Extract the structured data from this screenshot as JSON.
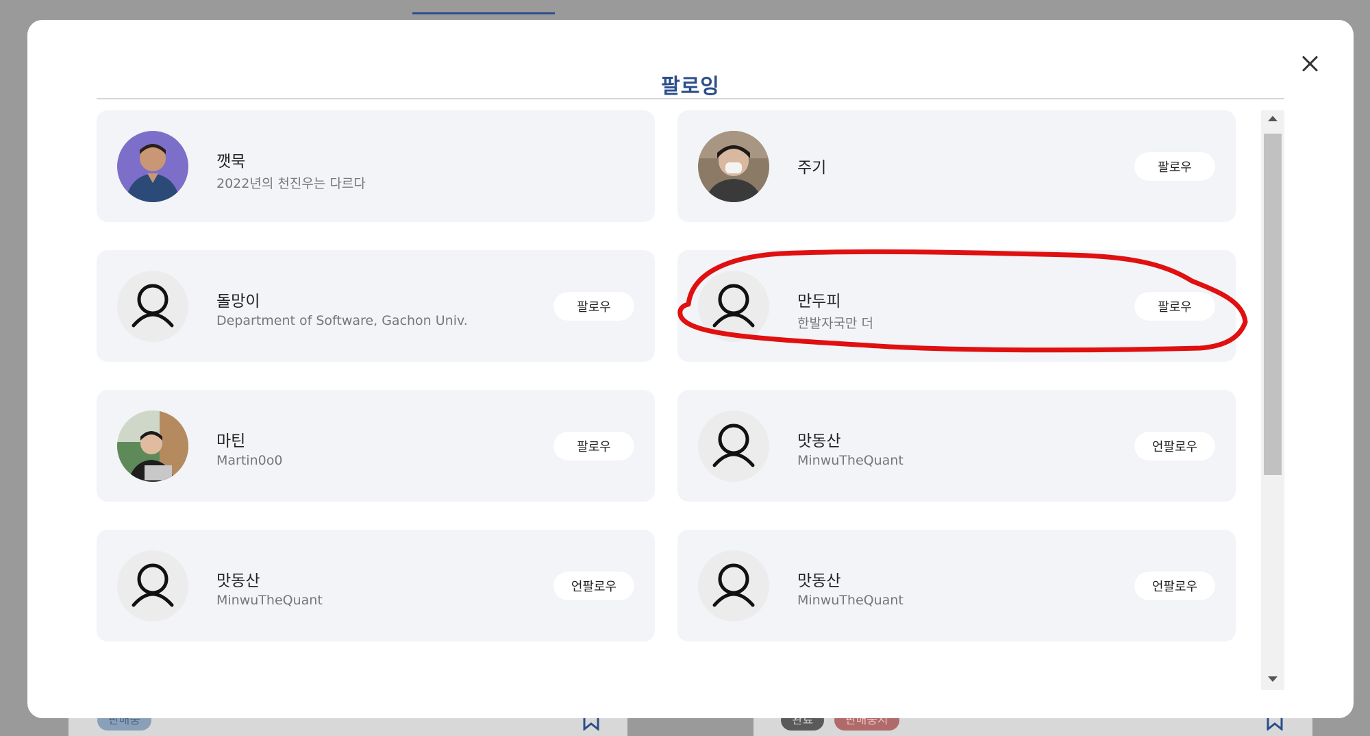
{
  "modal": {
    "title": "팔로잉",
    "close_icon": "close-icon"
  },
  "users": [
    {
      "name": "깻묵",
      "bio": "2022년의 천진우는 다르다",
      "button": "",
      "avatar": "photo"
    },
    {
      "name": "주기",
      "bio": "",
      "button": "팔로우",
      "avatar": "photo"
    },
    {
      "name": "돌망이",
      "bio": "Department of Software, Gachon Univ.",
      "button": "팔로우",
      "avatar": "user-icon"
    },
    {
      "name": "만두피",
      "bio": "한발자국만 더",
      "button": "팔로우",
      "avatar": "user-icon"
    },
    {
      "name": "마틴",
      "bio": "Martin0o0",
      "button": "팔로우",
      "avatar": "photo"
    },
    {
      "name": "맛동산",
      "bio": "MinwuTheQuant",
      "button": "언팔로우",
      "avatar": "user-icon"
    },
    {
      "name": "맛동산",
      "bio": "MinwuTheQuant",
      "button": "언팔로우",
      "avatar": "user-icon"
    },
    {
      "name": "맛동산",
      "bio": "MinwuTheQuant",
      "button": "언팔로우",
      "avatar": "user-icon"
    }
  ],
  "background": {
    "badges": [
      "판매중",
      "완료",
      "판매중지"
    ],
    "accent_color": "#2b4e8a",
    "annotation_color": "#e01010"
  }
}
